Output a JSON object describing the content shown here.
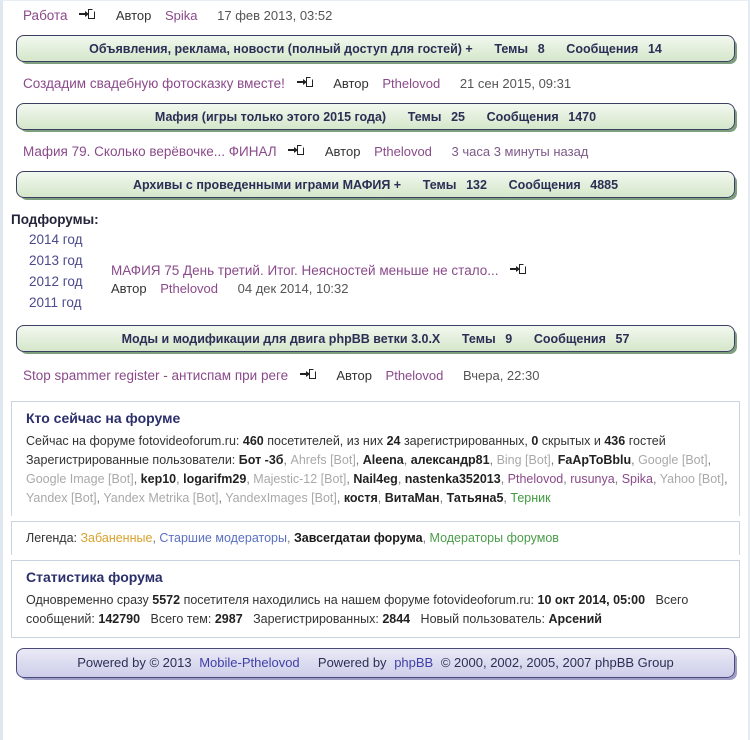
{
  "topics": {
    "t1": {
      "title": "Работа",
      "author_label": "Автор",
      "author": "Spika",
      "date": "17 фев 2013, 03:52"
    },
    "t2": {
      "title": "Создадим свадебную фотосказку вместе!",
      "author_label": "Автор",
      "author": "Pthelovod",
      "date": "21 сен 2015, 09:31"
    },
    "t3": {
      "title": "Мафия 79. Сколько верёвочке... ФИНАЛ",
      "author_label": "Автор",
      "author": "Pthelovod",
      "date": "3 часа 3 минуты назад"
    },
    "t4": {
      "title": "МАФИЯ 75 День третий. Итог. Неясностей меньше не стало...",
      "author_label": "Автор",
      "author": "Pthelovod",
      "date": "04 дек 2014, 10:32"
    },
    "t5": {
      "title": "Stop spammer register - антиспам при реге",
      "author_label": "Автор",
      "author": "Pthelovod",
      "date": "Вчера, 22:30"
    }
  },
  "forums": {
    "f1": {
      "name": "Объявления, реклама, новости (полный доступ для гостей) +",
      "topics_label": "Темы",
      "topics": "8",
      "posts_label": "Сообщения",
      "posts": "14"
    },
    "f2": {
      "name": "Мафия (игры только этого 2015 года)",
      "topics_label": "Темы",
      "topics": "25",
      "posts_label": "Сообщения",
      "posts": "1470"
    },
    "f3": {
      "name": "Архивы с проведенными играми МАФИЯ +",
      "topics_label": "Темы",
      "topics": "132",
      "posts_label": "Сообщения",
      "posts": "4885"
    },
    "f4": {
      "name": "Моды и модификации для двига phpBB ветки 3.0.X",
      "topics_label": "Темы",
      "topics": "9",
      "posts_label": "Сообщения",
      "posts": "57"
    }
  },
  "subforums": {
    "heading": "Подфорумы:",
    "items": [
      {
        "label": "2014 год"
      },
      {
        "label": "2013 год"
      },
      {
        "label": "2012 год"
      },
      {
        "label": "2011 год"
      }
    ]
  },
  "who_online": {
    "heading": "Кто сейчас на форуме",
    "summary_prefix": "Сейчас на форуме fotovideoforum.ru:",
    "total_visitors": "460",
    "summary_mid": "посетителей, из них",
    "registered_count": "24",
    "summary_mid2": "зарегистрированных,",
    "hidden_count": "0",
    "summary_mid3": "скрытых и",
    "guests_count": "436",
    "summary_suffix": "гостей",
    "users_label": "Зарегистрированные пользователи:",
    "users": [
      {
        "name": "Бот -3б",
        "style": "bold"
      },
      {
        "name": "Ahrefs [Bot]",
        "style": "bot"
      },
      {
        "name": "Aleena",
        "style": "bold"
      },
      {
        "name": "александр81",
        "style": "bold"
      },
      {
        "name": "Bing [Bot]",
        "style": "bot"
      },
      {
        "name": "FaApToBblu",
        "style": "bold"
      },
      {
        "name": "Google [Bot]",
        "style": "bot"
      },
      {
        "name": "Google Image [Bot]",
        "style": "bot"
      },
      {
        "name": "kep10",
        "style": "bold"
      },
      {
        "name": "logarifm29",
        "style": "bold"
      },
      {
        "name": "Majestic-12 [Bot]",
        "style": "bot"
      },
      {
        "name": "Nail4eg",
        "style": "bold"
      },
      {
        "name": "nastenka352013",
        "style": "bold"
      },
      {
        "name": "Pthelovod",
        "style": "normal"
      },
      {
        "name": "rusunya",
        "style": "normal"
      },
      {
        "name": "Spika",
        "style": "normal"
      },
      {
        "name": "Yahoo [Bot]",
        "style": "bot"
      },
      {
        "name": "Yandex [Bot]",
        "style": "bot"
      },
      {
        "name": "Yandex Metrika [Bot]",
        "style": "bot"
      },
      {
        "name": "YandexImages [Bot]",
        "style": "bot"
      },
      {
        "name": "костя",
        "style": "bold"
      },
      {
        "name": "ВитаМан",
        "style": "bold"
      },
      {
        "name": "Татьяна5",
        "style": "bold"
      },
      {
        "name": "Терник",
        "style": "green"
      }
    ]
  },
  "legend": {
    "label": "Легенда:",
    "items": [
      {
        "label": "Забаненные",
        "cls": "lg-banned"
      },
      {
        "label": "Старшие модераторы",
        "cls": "lg-smod"
      },
      {
        "label": "Завсегдатаи форума",
        "cls": "lg-regular"
      },
      {
        "label": "Модераторы форумов",
        "cls": "lg-mod"
      }
    ]
  },
  "stats": {
    "heading": "Статистика форума",
    "peak_prefix": "Одновременно сразу",
    "peak_count": "5572",
    "peak_mid": "посетителя находились на нашем форуме fotovideoforum.ru:",
    "peak_date": "10 окт 2014, 05:00",
    "posts_label": "Всего сообщений:",
    "posts_value": "142790",
    "topics_label": "Всего тем:",
    "topics_value": "2987",
    "members_label": "Зарегистрированных:",
    "members_value": "2844",
    "newest_label": "Новый пользователь:",
    "newest_value": "Арсений"
  },
  "footer": {
    "powered_by_1": "Powered by © 2013",
    "brand_1": "Mobile-Pthelovod",
    "powered_by_2": "Powered by",
    "brand_2": "phpBB",
    "copyright": "© 2000, 2002, 2005, 2007 phpBB Group"
  },
  "icons": {
    "goto_post": "goto-last-post-icon"
  }
}
